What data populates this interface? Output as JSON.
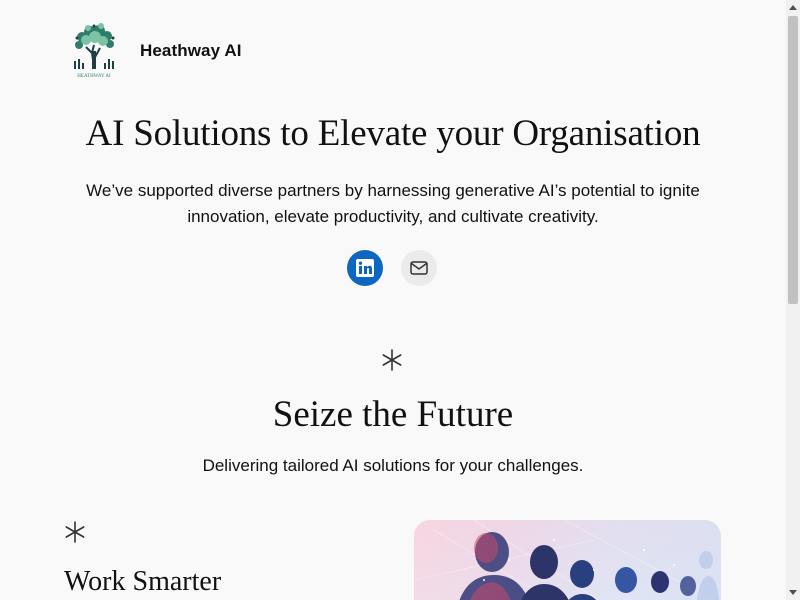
{
  "header": {
    "site_title": "Heathway AI",
    "logo_text": "HEATHWAY AI",
    "logo_icon": "tree-logo"
  },
  "hero": {
    "title": "AI Solutions to Elevate your Organisation",
    "text": "We’ve supported diverse partners by harnessing generative AI’s potential to ignite innovation, elevate productivity, and cultivate creativity.",
    "social": [
      {
        "name": "linkedin",
        "icon": "linkedin-icon",
        "color": "#0d66c2"
      },
      {
        "name": "mail",
        "icon": "mail-icon",
        "color": "#ebebeb"
      }
    ]
  },
  "section": {
    "title": "Seize the Future",
    "subtitle": "Delivering tailored AI solutions for your challenges."
  },
  "feature": {
    "title": "Work Smarter"
  },
  "colors": {
    "background": "#f9f9f9",
    "text": "#111111",
    "linkedin": "#0d66c2"
  }
}
